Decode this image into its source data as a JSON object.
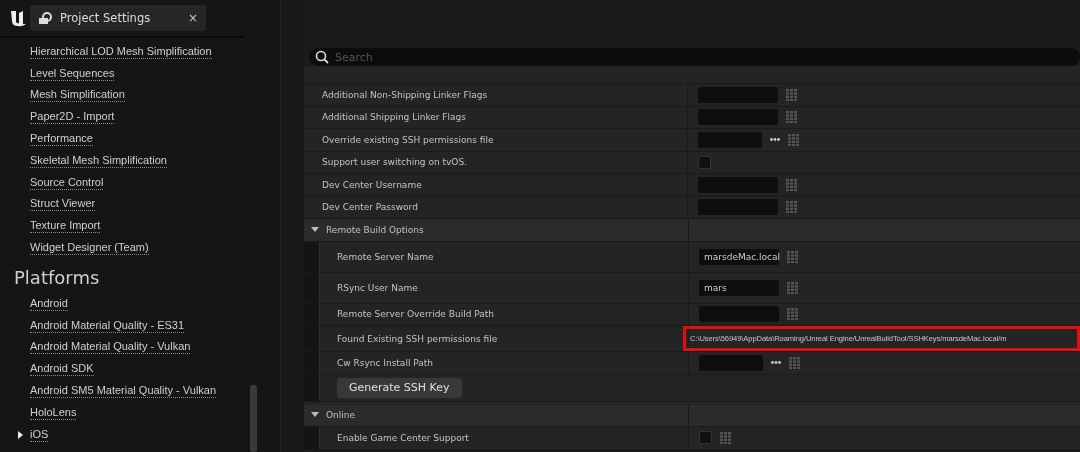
{
  "tab": {
    "title": "Project Settings",
    "close": "×"
  },
  "sidebar": {
    "items": [
      {
        "label": "Hierarchical LOD Mesh Simplification"
      },
      {
        "label": "Level Sequences"
      },
      {
        "label": "Mesh Simplification"
      },
      {
        "label": "Paper2D - Import"
      },
      {
        "label": "Performance"
      },
      {
        "label": "Skeletal Mesh Simplification"
      },
      {
        "label": "Source Control"
      },
      {
        "label": "Struct Viewer"
      },
      {
        "label": "Texture Import"
      },
      {
        "label": "Widget Designer (Team)"
      }
    ],
    "sections": [
      {
        "title": "Platforms",
        "items": [
          {
            "label": "Android"
          },
          {
            "label": "Android Material Quality - ES31"
          },
          {
            "label": "Android Material Quality - Vulkan"
          },
          {
            "label": "Android SDK"
          },
          {
            "label": "Android SM5 Material Quality - Vulkan"
          },
          {
            "label": "HoloLens"
          },
          {
            "label": "iOS",
            "expanded": false
          }
        ]
      }
    ]
  },
  "details": {
    "search": {
      "placeholder": "Search"
    },
    "rows": [
      {
        "kind": "text",
        "label": "Additional Non-Shipping Linker Flags"
      },
      {
        "kind": "text",
        "label": "Additional Shipping Linker Flags"
      },
      {
        "kind": "file",
        "label": "Override existing SSH permissions file"
      },
      {
        "kind": "checkbox",
        "label": "Support user switching on tvOS.",
        "checked": false
      },
      {
        "kind": "text",
        "label": "Dev Center Username"
      },
      {
        "kind": "text",
        "label": "Dev Center Password"
      },
      {
        "kind": "category",
        "label": "Remote Build Options",
        "expanded": true,
        "children": [
          {
            "kind": "text",
            "label": "Remote Server Name",
            "value": "marsdeMac.local"
          },
          {
            "kind": "text",
            "label": "RSync User Name",
            "value": "mars"
          },
          {
            "kind": "text",
            "label": "Remote Server Override Build Path"
          },
          {
            "kind": "readonly",
            "label": "Found Existing SSH permissions file",
            "value": "C:\\Users\\56949\\AppData\\Roaming/Unreal Engine/UnrealBuildTool/SSHKeys/marsdeMac.local/m",
            "highlighted": true
          },
          {
            "kind": "file",
            "label": "Cw Rsync Install Path"
          },
          {
            "kind": "button",
            "label": "Generate SSH Key"
          }
        ]
      },
      {
        "kind": "category",
        "label": "Online",
        "expanded": true,
        "children": [
          {
            "kind": "checkbox",
            "label": "Enable Game Center Support",
            "checked": false,
            "array": true
          }
        ]
      }
    ]
  }
}
